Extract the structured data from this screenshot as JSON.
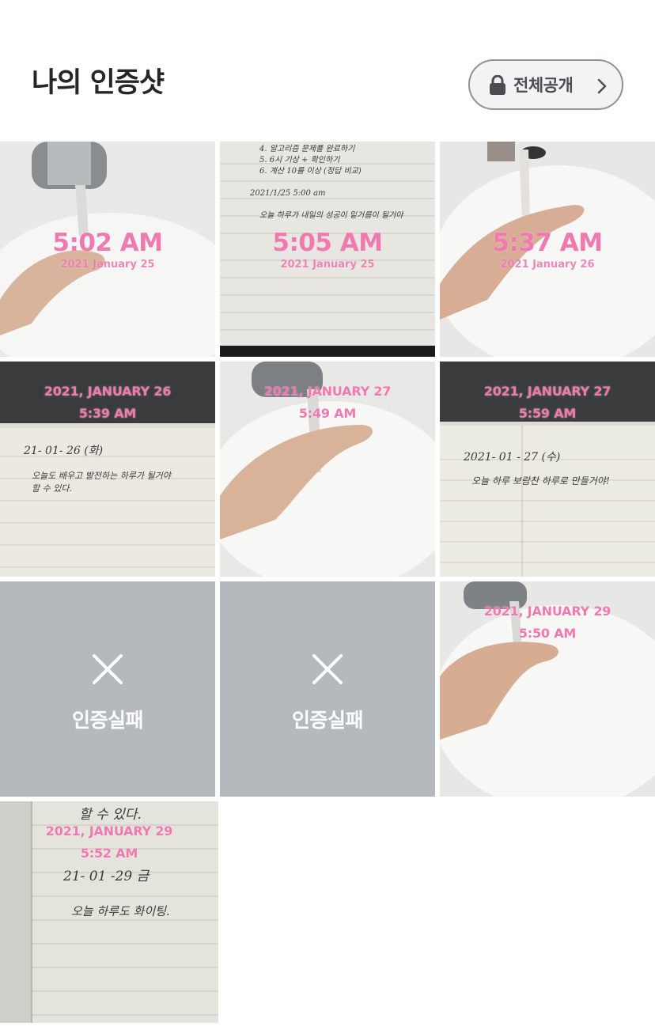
{
  "header": {
    "title": "나의 인증샷",
    "visibility_label": "전체공개",
    "lock_icon": "lock-icon",
    "chevron_icon": "chevron-right-icon"
  },
  "colors": {
    "stamp_pink": "#f07ab0",
    "fail_gray": "#b4b9be",
    "button_border": "#8e9197"
  },
  "photos": [
    {
      "kind": "photo",
      "subject": "hand-washing",
      "time": "5:02 AM",
      "date": "2021 January 25"
    },
    {
      "kind": "photo",
      "subject": "notebook",
      "time": "5:05 AM",
      "date": "2021 January 25",
      "notes": [
        "4. 알고리즘 문제풀 완료하기",
        "5. 6시 기상 + 확인하기",
        "6. 계산 10를 이상 (정답 비교)",
        "2021/1/25  5:00 am",
        "오늘 하루가 내일의 성공이 밑거름이 될거야"
      ]
    },
    {
      "kind": "photo",
      "subject": "hand-washing",
      "time": "5:37 AM",
      "date": "2021 January 26"
    },
    {
      "kind": "photo",
      "subject": "notebook",
      "date_upper": "2021, JANUARY 26",
      "time": "5:39 AM",
      "notes": [
        "21- 01- 26 (화)",
        "오늘도 배우고 발전하는 하루가 될거야",
        "할 수 있다."
      ]
    },
    {
      "kind": "photo",
      "subject": "hand-washing",
      "date_upper": "2021, JANUARY 27",
      "time": "5:49 AM"
    },
    {
      "kind": "photo",
      "subject": "notebook",
      "date_upper": "2021, JANUARY 27",
      "time": "5:59 AM",
      "notes": [
        "2021- 01 - 27 (수)",
        "오늘 하루 보람찬 하루로 만들거야!"
      ]
    },
    {
      "kind": "fail",
      "label": "인증실패",
      "icon": "close-icon"
    },
    {
      "kind": "fail",
      "label": "인증실패",
      "icon": "close-icon"
    },
    {
      "kind": "photo",
      "subject": "hand-washing",
      "date_upper": "2021, JANUARY 29",
      "time": "5:50 AM"
    },
    {
      "kind": "photo",
      "subject": "notebook",
      "date_upper": "2021, JANUARY 29",
      "time": "5:52 AM",
      "notes": [
        "할 수 있다.",
        "21- 01 -29 금",
        "오늘 하루도 화이팅."
      ]
    }
  ]
}
